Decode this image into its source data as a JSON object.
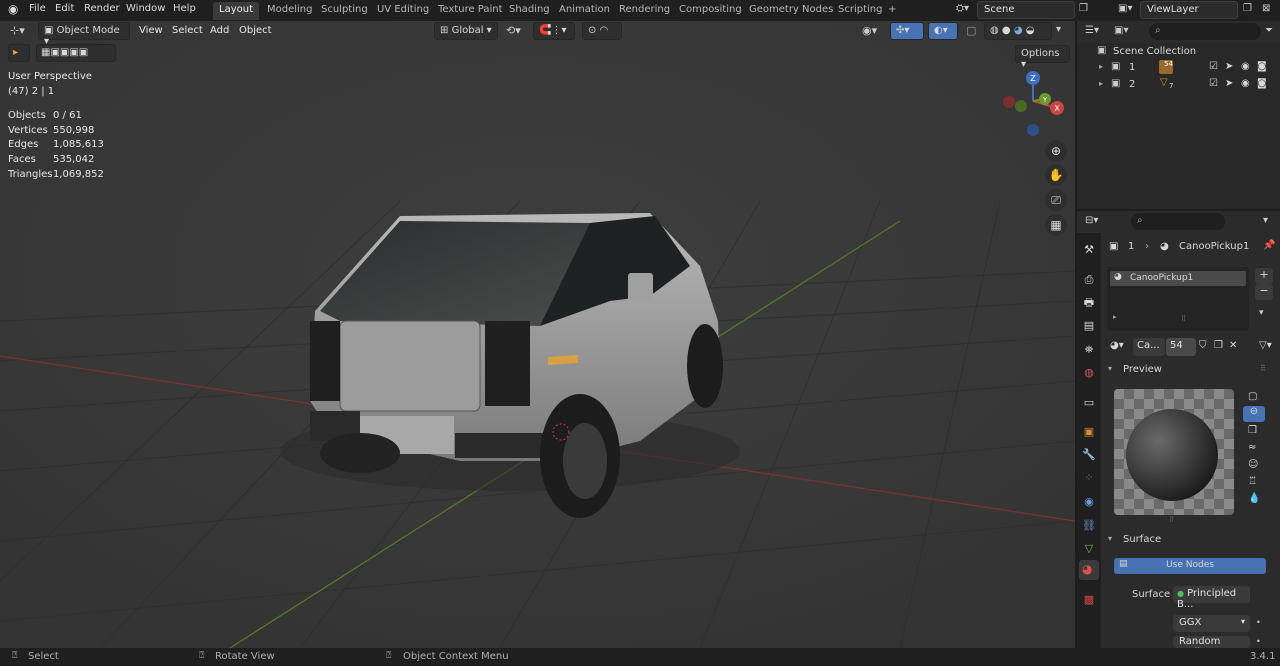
{
  "menubar": {
    "items": [
      "File",
      "Edit",
      "Render",
      "Window",
      "Help"
    ],
    "workspaces": [
      "Layout",
      "Modeling",
      "Sculpting",
      "UV Editing",
      "Texture Paint",
      "Shading",
      "Animation",
      "Rendering",
      "Compositing",
      "Geometry Nodes",
      "Scripting"
    ],
    "active_workspace": "Layout",
    "add_tab": "+",
    "scene": "Scene",
    "view_layer": "ViewLayer"
  },
  "viewport_header": {
    "mode": "Object Mode",
    "menus": [
      "View",
      "Select",
      "Add",
      "Object"
    ],
    "transform_orientation": "Global",
    "options": "Options"
  },
  "overlay": {
    "view_name": "User Perspective",
    "collection_info": "(47) 2 | 1",
    "stats": [
      {
        "label": "Objects",
        "value": "0 / 61"
      },
      {
        "label": "Vertices",
        "value": "550,998"
      },
      {
        "label": "Edges",
        "value": "1,085,613"
      },
      {
        "label": "Faces",
        "value": "535,042"
      },
      {
        "label": "Triangles",
        "value": "1,069,852"
      }
    ]
  },
  "gizmo": {
    "z": "Z",
    "y": "Y",
    "x": "X"
  },
  "outliner": {
    "root": "Scene Collection",
    "rows": [
      {
        "name": "1",
        "badge": "54"
      },
      {
        "name": "2",
        "badge": "7"
      }
    ]
  },
  "properties": {
    "breadcrumb_num": "1",
    "breadcrumb_obj": "CanooPickup1",
    "material_slot": "CanooPickup1",
    "material_short": "Ca...",
    "users": "54",
    "preview_label": "Preview",
    "surface_panel": "Surface",
    "use_nodes": "Use Nodes",
    "surface_label": "Surface",
    "surface_value": "Principled B...",
    "distribution": "GGX",
    "subsurface": "Random Walk"
  },
  "statusbar": {
    "select": "Select",
    "rotate": "Rotate View",
    "context": "Object Context Menu",
    "version": "3.4.1"
  },
  "colors": {
    "accent_blue": "#4772b3",
    "x_axis": "#a03a3a",
    "y_axis": "#5c8a2a",
    "viewport_bg": "#393939"
  }
}
